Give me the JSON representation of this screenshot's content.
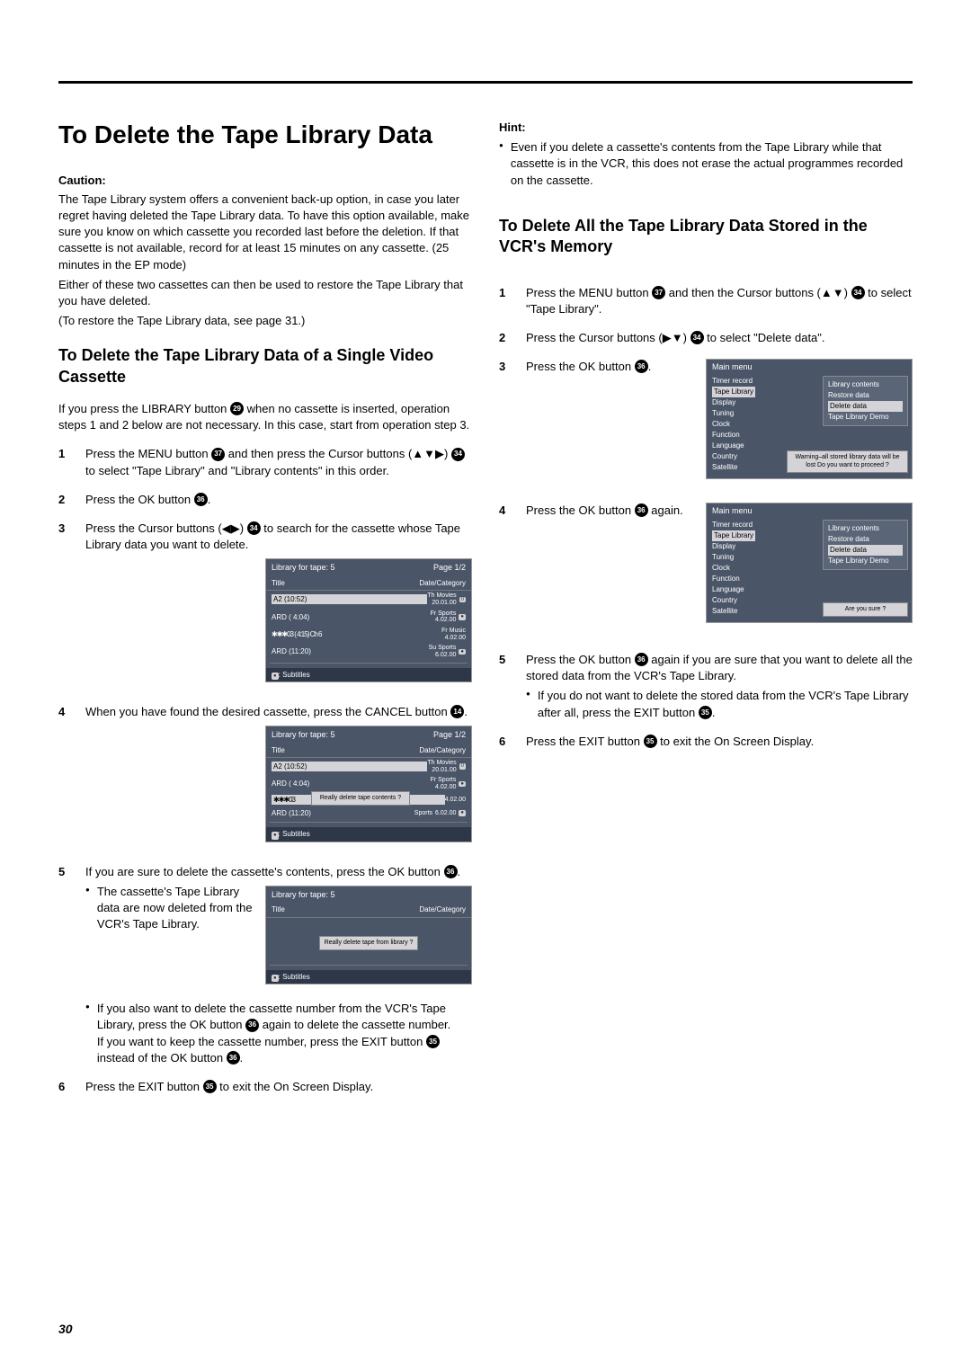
{
  "title": "To Delete the Tape Library Data",
  "caution_label": "Caution:",
  "caution_text": "The Tape Library system offers a convenient back-up option, in case you later regret having deleted the Tape Library data. To have this option available, make sure you know on which cassette you recorded last before the deletion. If that cassette is not available, record for at least 15 minutes on any cassette. (25 minutes in the EP mode)",
  "caution_text2": "Either of these two cassettes can then be used to restore the Tape Library that you have deleted.",
  "caution_text3": "(To restore the Tape Library data, see page 31.)",
  "section1_title": "To Delete the Tape Library Data of a Single Video Cassette",
  "section1_intro_a": "If you press the LIBRARY button ",
  "section1_intro_b": " when no cassette is inserted, operation steps 1 and 2 below are not necessary. In this case, start from operation step 3.",
  "s1_step1a": "Press the MENU button ",
  "s1_step1b": " and then press the Cursor buttons (▲▼▶) ",
  "s1_step1c": " to select \"Tape Library\" and \"Library contents\" in this order.",
  "s1_step2a": "Press the OK button ",
  "s1_step2b": ".",
  "s1_step3a": "Press the Cursor buttons (◀▶) ",
  "s1_step3b": " to search for the cassette whose Tape Library data you want to delete.",
  "s1_step4a": "When you have found the desired cassette, press the CANCEL button ",
  "s1_step4b": ".",
  "s1_step5a": "If you are sure to delete the cassette's contents, press the OK button ",
  "s1_step5b": ".",
  "s1_step5_bullet": "The cassette's Tape Library data are now deleted from the VCR's Tape Library.",
  "s1_step5_bullet2a": "If you also want to delete the cassette number from the VCR's Tape Library, press the OK button ",
  "s1_step5_bullet2b": " again to delete the cassette number.",
  "s1_step5_bullet2c": "If you want to keep the cassette number, press the EXIT button ",
  "s1_step5_bullet2d": " instead of the OK button ",
  "s1_step5_bullet2e": ".",
  "s1_step6a": "Press the EXIT button ",
  "s1_step6b": " to exit the On Screen Display.",
  "hint_label": "Hint:",
  "hint_bullet": "Even if you delete a cassette's contents from the Tape Library while that cassette is in the VCR, this does not erase the actual programmes recorded on the cassette.",
  "section2_title": "To Delete All the Tape Library Data Stored in the VCR's Memory",
  "s2_step1a": "Press the MENU button ",
  "s2_step1b": " and then the Cursor buttons (▲▼) ",
  "s2_step1c": " to select \"Tape Library\".",
  "s2_step2a": "Press the Cursor buttons (▶▼) ",
  "s2_step2b": " to select \"Delete data\".",
  "s2_step3a": "Press the OK button ",
  "s2_step3b": ".",
  "s2_step4a": "Press the OK button ",
  "s2_step4b": " again.",
  "s2_step5a": "Press the OK button ",
  "s2_step5b": " again if you are sure that you want to delete all the stored data from the VCR's Tape Library.",
  "s2_step5_bullet_a": "If you do not want to delete the stored data from the VCR's Tape Library after all, press the EXIT button ",
  "s2_step5_bullet_b": ".",
  "s2_step6a": "Press the EXIT button ",
  "s2_step6b": " to exit the On Screen Display.",
  "icons": {
    "i14": "14",
    "i29": "29",
    "i34": "34",
    "i35": "35",
    "i36": "36",
    "i37": "37"
  },
  "osd1": {
    "header_l": "Library for tape: 5",
    "header_r": "Page 1/2",
    "col_l": "Title",
    "col_r": "Date/Category",
    "rows": [
      {
        "l": "A2 (10:52)",
        "d": "Th Movies",
        "t": "20.01.00",
        "rec": "0"
      },
      {
        "l": "ARD ( 4:04)",
        "d": "Fr Sports",
        "t": "4.02.00",
        "rec": "●"
      },
      {
        "l": "✱✱✱03 ( 4:15) Ch 6",
        "d": "Fr Music",
        "t": "4.02.00",
        "rec": ""
      },
      {
        "l": "ARD (11:20)",
        "d": "Su Sports",
        "t": "6.02.00",
        "rec": "●"
      }
    ],
    "foot": ": Subtitles",
    "foot_icon": "●"
  },
  "osd2": {
    "header_l": "Library for tape: 5",
    "header_r": "Page 1/2",
    "col_l": "Title",
    "col_r": "Date/Category",
    "rows": [
      {
        "l": "A2 (10:52)",
        "d": "Th Movies",
        "t": "20.01.00",
        "rec": "0"
      },
      {
        "l": "ARD ( 4:04)",
        "d": "Fr Sports",
        "t": "4.02.00",
        "rec": "●"
      },
      {
        "l": "✱✱✱03",
        "d": "",
        "t": "4.02.00",
        "rec": ""
      },
      {
        "l": "ARD (11:20)",
        "d": "Sports",
        "t": "6.02.00",
        "rec": "●"
      }
    ],
    "dialog": "Really delete tape contents ?",
    "foot": ": Subtitles",
    "foot_icon": "●"
  },
  "osd3": {
    "header_l": "Library for tape: 5",
    "col_l": "Title",
    "col_r": "Date/Category",
    "dialog": "Really delete tape from library ?",
    "foot": ": Subtitles",
    "foot_icon": "●"
  },
  "menu": {
    "head": "Main menu",
    "items": [
      "Timer record",
      "Tape Library",
      "Display",
      "Tuning",
      "Clock",
      "Function",
      "Language",
      "Country",
      "Satellite"
    ],
    "sub": [
      "Library contents",
      "Restore data",
      "Delete data",
      "Tape Library Demo"
    ],
    "warn1": "Warning–all stored library data will be lost Do you want to proceed ?",
    "warn2": "Are you sure ?"
  },
  "page_number": "30"
}
